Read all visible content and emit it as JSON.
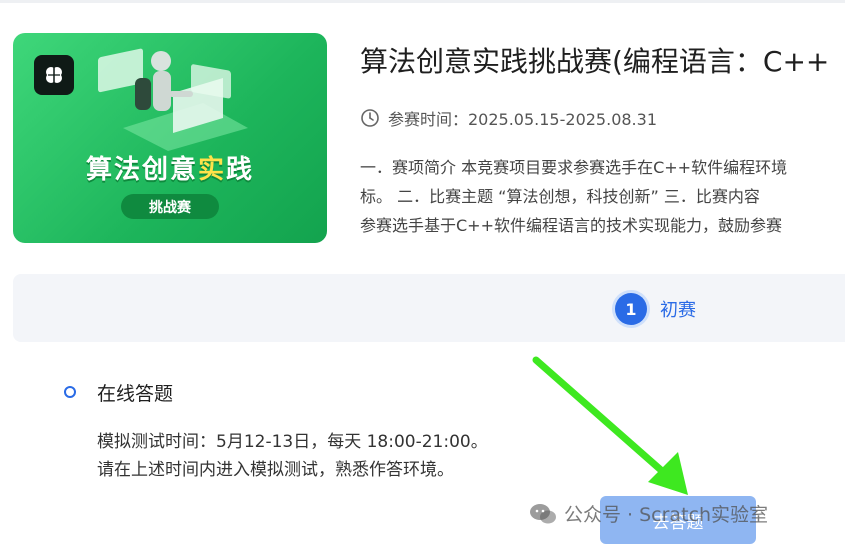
{
  "banner": {
    "title_part1": "算法创意",
    "title_part2": "实",
    "title_part3": "践",
    "pill": "挑战赛",
    "badge_icon": "brain-icon",
    "bg_color": "#1db55b"
  },
  "competition": {
    "title": "算法创意实践挑战赛(编程语言：C++",
    "time_label": "参赛时间：2025.05.15-2025.08.31",
    "description_lines": [
      "一．赛项简介 本竞赛项目要求参赛选手在C++软件编程环境",
      "标。 二．比赛主题 “算法创想，科技创新” 三．比赛内容",
      "参赛选手基于C++软件编程语言的技术实现能力，鼓励参赛"
    ]
  },
  "stage": {
    "number": "1",
    "label": "初赛",
    "accent": "#2a6be6"
  },
  "round": {
    "title": "在线答题",
    "lines": [
      "模拟测试时间：5月12-13日，每天 18:00-21:00。",
      "请在上述时间内进入模拟测试，熟悉作答环境。"
    ],
    "button_label": "去答题"
  },
  "watermark": {
    "text": "公众号 · Scratch实验室",
    "icon": "wechat-icon"
  },
  "annotation": {
    "arrow_color": "#3ee820"
  }
}
